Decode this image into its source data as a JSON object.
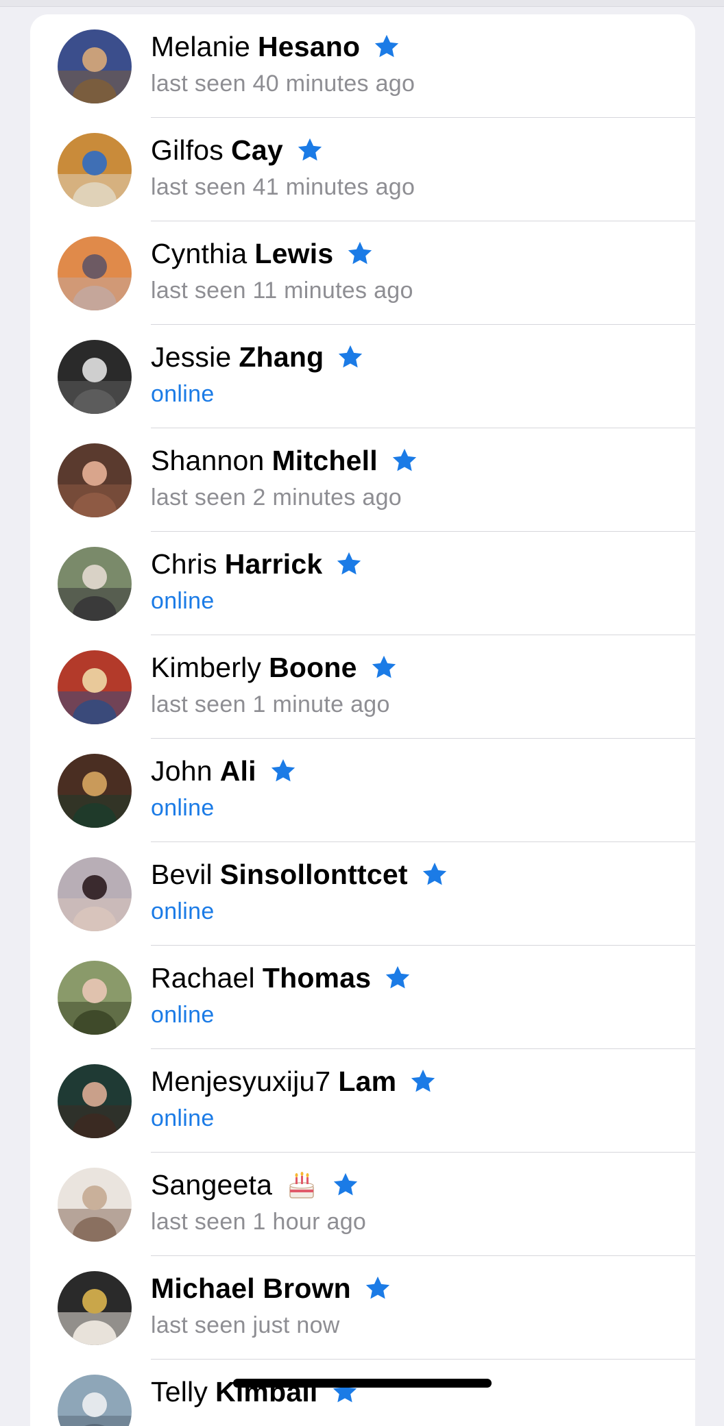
{
  "contacts": [
    {
      "first": "Melanie",
      "last": "Hesano",
      "status": "last seen 40 minutes ago",
      "online": false,
      "colors": [
        "#3b4e8c",
        "#c9a07a",
        "#7a5d3e"
      ]
    },
    {
      "first": "Gilfos",
      "last": "Cay",
      "status": "last seen 41 minutes ago",
      "online": false,
      "colors": [
        "#c98b3a",
        "#3f6fb5",
        "#e0d2b8"
      ]
    },
    {
      "first": "Cynthia",
      "last": "Lewis",
      "status": "last seen 11 minutes ago",
      "online": false,
      "colors": [
        "#e08a4a",
        "#6d5a63",
        "#c5a69a"
      ]
    },
    {
      "first": "Jessie",
      "last": "Zhang",
      "status": "online",
      "online": true,
      "colors": [
        "#2a2a2a",
        "#cfcfcf",
        "#5c5c5c"
      ]
    },
    {
      "first": "Shannon",
      "last": "Mitchell",
      "status": "last seen 2 minutes ago",
      "online": false,
      "colors": [
        "#5a3a2e",
        "#d9a58c",
        "#8e5a44"
      ]
    },
    {
      "first": "Chris",
      "last": "Harrick",
      "status": "online",
      "online": true,
      "colors": [
        "#7a8a6a",
        "#d9d2c6",
        "#3a3a3a"
      ]
    },
    {
      "first": "Kimberly",
      "last": "Boone",
      "status": "last seen 1 minute ago",
      "online": false,
      "colors": [
        "#b33a2a",
        "#e9c99a",
        "#3a4a7a"
      ]
    },
    {
      "first": "John",
      "last": "Ali",
      "status": "online",
      "online": true,
      "colors": [
        "#4a2e22",
        "#c99a5a",
        "#1f3a2a"
      ]
    },
    {
      "first": "Bevil",
      "last": "Sinsollonttcet",
      "status": "online",
      "online": true,
      "colors": [
        "#b8aeb6",
        "#3a2a2e",
        "#d8c4bc"
      ]
    },
    {
      "first": "Rachael",
      "last": "Thomas",
      "status": "online",
      "online": true,
      "colors": [
        "#8a9a6a",
        "#e0c2ae",
        "#3f4a2a"
      ]
    },
    {
      "first": "Menjesyuxiju7",
      "last": "Lam",
      "status": "online",
      "online": true,
      "colors": [
        "#1f3a34",
        "#c9a08a",
        "#3a2a22"
      ]
    },
    {
      "first": "Sangeeta",
      "last": "",
      "status": "last seen 1 hour ago",
      "online": false,
      "cake": true,
      "colors": [
        "#eae4de",
        "#c9b09a",
        "#8a7060"
      ]
    },
    {
      "first": "",
      "last": "Michael Brown",
      "status": "last seen just now",
      "online": false,
      "colors": [
        "#2a2a2a",
        "#c9a64a",
        "#e8e2da"
      ]
    },
    {
      "first": "Telly",
      "last": "Kimball",
      "status": "",
      "online": false,
      "colors": [
        "#8ea6b8",
        "#e4e8ec",
        "#5a6a7a"
      ]
    }
  ],
  "icons": {
    "favorite": "star-icon",
    "birthday": "cake-icon"
  },
  "colors": {
    "accent": "#1b7be6",
    "secondary_text": "#8e8e93",
    "background": "#efeff4"
  }
}
